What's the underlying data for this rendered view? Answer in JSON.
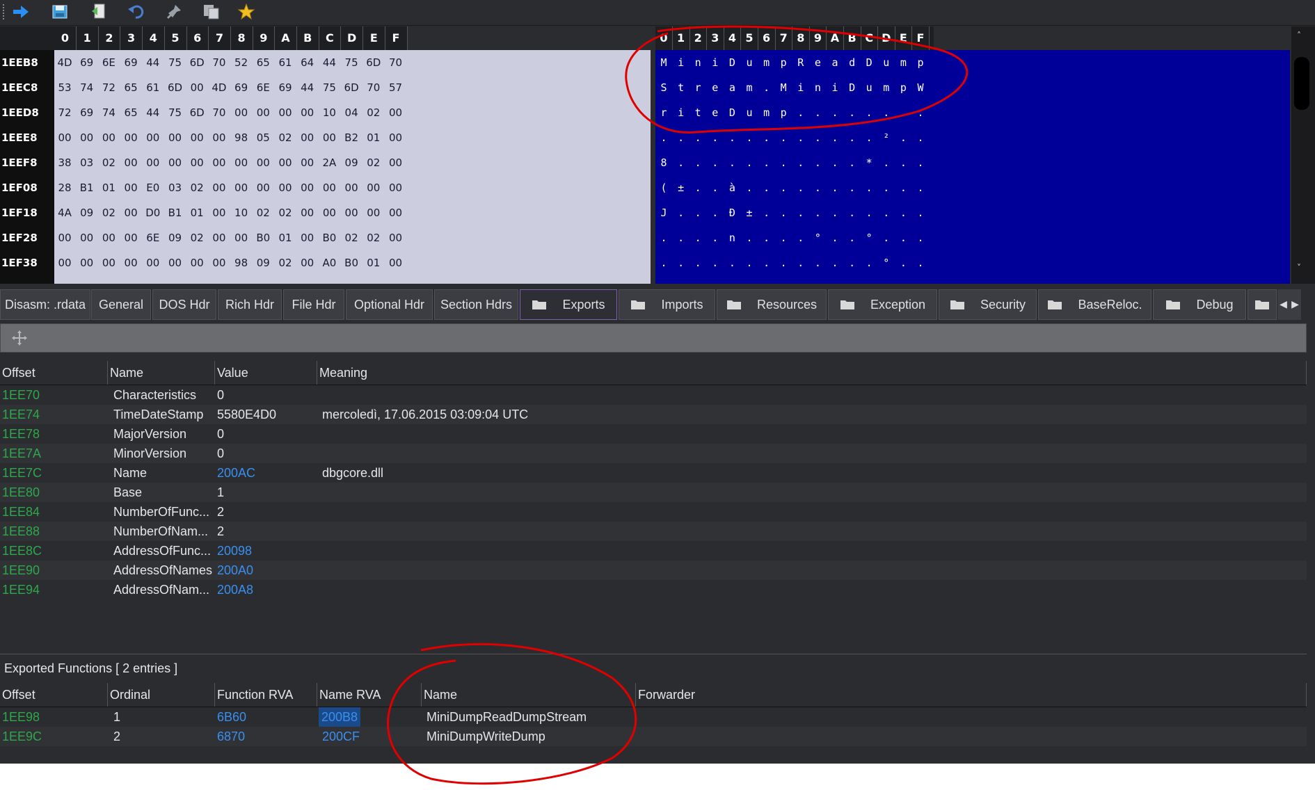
{
  "toolbar": {
    "buttons": [
      {
        "name": "forward-icon",
        "color": "#2a8ff0"
      },
      {
        "name": "save-icon",
        "color": "#3aa0e0"
      },
      {
        "name": "export-icon",
        "color": "#5cb85c"
      },
      {
        "name": "undo-icon",
        "color": "#4a7fd0"
      },
      {
        "name": "pin-icon",
        "color": "#9aa0a8"
      },
      {
        "name": "copy-icon",
        "color": "#b0b4ba"
      },
      {
        "name": "star-icon",
        "color": "#f0c020"
      }
    ]
  },
  "hex": {
    "columns": [
      "0",
      "1",
      "2",
      "3",
      "4",
      "5",
      "6",
      "7",
      "8",
      "9",
      "A",
      "B",
      "C",
      "D",
      "E",
      "F"
    ],
    "rows": [
      {
        "addr": "1EEB8",
        "bytes": [
          "4D",
          "69",
          "6E",
          "69",
          "44",
          "75",
          "6D",
          "70",
          "52",
          "65",
          "61",
          "64",
          "44",
          "75",
          "6D",
          "70"
        ],
        "ascii": [
          "M",
          "i",
          "n",
          "i",
          "D",
          "u",
          "m",
          "p",
          "R",
          "e",
          "a",
          "d",
          "D",
          "u",
          "m",
          "p"
        ]
      },
      {
        "addr": "1EEC8",
        "bytes": [
          "53",
          "74",
          "72",
          "65",
          "61",
          "6D",
          "00",
          "4D",
          "69",
          "6E",
          "69",
          "44",
          "75",
          "6D",
          "70",
          "57"
        ],
        "ascii": [
          "S",
          "t",
          "r",
          "e",
          "a",
          "m",
          ".",
          "M",
          "i",
          "n",
          "i",
          "D",
          "u",
          "m",
          "p",
          "W"
        ]
      },
      {
        "addr": "1EED8",
        "bytes": [
          "72",
          "69",
          "74",
          "65",
          "44",
          "75",
          "6D",
          "70",
          "00",
          "00",
          "00",
          "00",
          "10",
          "04",
          "02",
          "00"
        ],
        "ascii": [
          "r",
          "i",
          "t",
          "e",
          "D",
          "u",
          "m",
          "p",
          ".",
          ".",
          ".",
          ".",
          ".",
          ".",
          ".",
          "."
        ]
      },
      {
        "addr": "1EEE8",
        "bytes": [
          "00",
          "00",
          "00",
          "00",
          "00",
          "00",
          "00",
          "00",
          "98",
          "05",
          "02",
          "00",
          "00",
          "B2",
          "01",
          "00"
        ],
        "ascii": [
          ".",
          ".",
          ".",
          ".",
          ".",
          ".",
          ".",
          ".",
          ".",
          ".",
          ".",
          ".",
          ".",
          "²",
          ".",
          "."
        ]
      },
      {
        "addr": "1EEF8",
        "bytes": [
          "38",
          "03",
          "02",
          "00",
          "00",
          "00",
          "00",
          "00",
          "00",
          "00",
          "00",
          "00",
          "2A",
          "09",
          "02",
          "00"
        ],
        "ascii": [
          "8",
          ".",
          ".",
          ".",
          ".",
          ".",
          ".",
          ".",
          ".",
          ".",
          ".",
          ".",
          "*",
          ".",
          ".",
          "."
        ]
      },
      {
        "addr": "1EF08",
        "bytes": [
          "28",
          "B1",
          "01",
          "00",
          "E0",
          "03",
          "02",
          "00",
          "00",
          "00",
          "00",
          "00",
          "00",
          "00",
          "00",
          "00"
        ],
        "ascii": [
          "(",
          "±",
          ".",
          ".",
          "à",
          ".",
          ".",
          ".",
          ".",
          ".",
          ".",
          ".",
          ".",
          ".",
          ".",
          "."
        ]
      },
      {
        "addr": "1EF18",
        "bytes": [
          "4A",
          "09",
          "02",
          "00",
          "D0",
          "B1",
          "01",
          "00",
          "10",
          "02",
          "02",
          "00",
          "00",
          "00",
          "00",
          "00"
        ],
        "ascii": [
          "J",
          ".",
          ".",
          ".",
          "Ð",
          "±",
          ".",
          ".",
          ".",
          ".",
          ".",
          ".",
          ".",
          ".",
          ".",
          "."
        ]
      },
      {
        "addr": "1EF28",
        "bytes": [
          "00",
          "00",
          "00",
          "00",
          "6E",
          "09",
          "02",
          "00",
          "00",
          "B0",
          "01",
          "00",
          "B0",
          "02",
          "02",
          "00"
        ],
        "ascii": [
          ".",
          ".",
          ".",
          ".",
          "n",
          ".",
          ".",
          ".",
          ".",
          "°",
          ".",
          ".",
          "°",
          ".",
          ".",
          "."
        ]
      },
      {
        "addr": "1EF38",
        "bytes": [
          "00",
          "00",
          "00",
          "00",
          "00",
          "00",
          "00",
          "00",
          "98",
          "09",
          "02",
          "00",
          "A0",
          "B0",
          "01",
          "00"
        ],
        "ascii": [
          ".",
          ".",
          ".",
          ".",
          ".",
          ".",
          ".",
          ".",
          ".",
          ".",
          ".",
          ".",
          ".",
          "°",
          ".",
          "."
        ]
      }
    ],
    "scroll_up": "˄",
    "scroll_down": "˅"
  },
  "tabs": [
    {
      "label": "Disasm: .rdata",
      "folder": false
    },
    {
      "label": "General",
      "folder": false
    },
    {
      "label": "DOS Hdr",
      "folder": false
    },
    {
      "label": "Rich Hdr",
      "folder": false
    },
    {
      "label": "File Hdr",
      "folder": false
    },
    {
      "label": "Optional Hdr",
      "folder": false
    },
    {
      "label": "Section Hdrs",
      "folder": false
    },
    {
      "label": "Exports",
      "folder": true,
      "active": true
    },
    {
      "label": "Imports",
      "folder": true
    },
    {
      "label": "Resources",
      "folder": true
    },
    {
      "label": "Exception",
      "folder": true
    },
    {
      "label": "Security",
      "folder": true
    },
    {
      "label": "BaseReloc.",
      "folder": true
    },
    {
      "label": "Debug",
      "folder": true
    },
    {
      "label": "",
      "folder": true
    }
  ],
  "tab_arrows": {
    "left": "◀",
    "right": "▶"
  },
  "subbar": {
    "icon": "move-icon"
  },
  "export_dir": {
    "headers": [
      "Offset",
      "Name",
      "Value",
      "Meaning"
    ],
    "rows": [
      {
        "offset": "1EE70",
        "name": "Characteristics",
        "value": "0",
        "value_link": false,
        "meaning": ""
      },
      {
        "offset": "1EE74",
        "name": "TimeDateStamp",
        "value": "5580E4D0",
        "value_link": false,
        "meaning": "mercoledì, 17.06.2015 03:09:04 UTC"
      },
      {
        "offset": "1EE78",
        "name": "MajorVersion",
        "value": "0",
        "value_link": false,
        "meaning": ""
      },
      {
        "offset": "1EE7A",
        "name": "MinorVersion",
        "value": "0",
        "value_link": false,
        "meaning": ""
      },
      {
        "offset": "1EE7C",
        "name": "Name",
        "value": "200AC",
        "value_link": true,
        "meaning": "dbgcore.dll"
      },
      {
        "offset": "1EE80",
        "name": "Base",
        "value": "1",
        "value_link": false,
        "meaning": ""
      },
      {
        "offset": "1EE84",
        "name": "NumberOfFunc...",
        "value": "2",
        "value_link": false,
        "meaning": ""
      },
      {
        "offset": "1EE88",
        "name": "NumberOfNam...",
        "value": "2",
        "value_link": false,
        "meaning": ""
      },
      {
        "offset": "1EE8C",
        "name": "AddressOfFunc...",
        "value": "20098",
        "value_link": true,
        "meaning": ""
      },
      {
        "offset": "1EE90",
        "name": "AddressOfNames",
        "value": "200A0",
        "value_link": true,
        "meaning": ""
      },
      {
        "offset": "1EE94",
        "name": "AddressOfNam...",
        "value": "200A8",
        "value_link": true,
        "meaning": ""
      }
    ]
  },
  "exported": {
    "label": "Exported Functions     [ 2 entries ]",
    "headers": [
      "Offset",
      "Ordinal",
      "Function RVA",
      "Name RVA",
      "Name",
      "Forwarder"
    ],
    "rows": [
      {
        "offset": "1EE98",
        "ordinal": "1",
        "func_rva": "6B60",
        "name_rva": "200B8",
        "name": "MiniDumpReadDumpStream",
        "forwarder": "",
        "selected": true
      },
      {
        "offset": "1EE9C",
        "ordinal": "2",
        "func_rva": "6870",
        "name_rva": "200CF",
        "name": "MiniDumpWriteDump",
        "forwarder": "",
        "selected": false
      }
    ]
  },
  "colors": {
    "annotation": "#e00000",
    "ascii_bg": "#000099",
    "hex_bg": "#cccdde",
    "offset_green": "#2ea84a",
    "link_blue": "#3a8ff0"
  }
}
